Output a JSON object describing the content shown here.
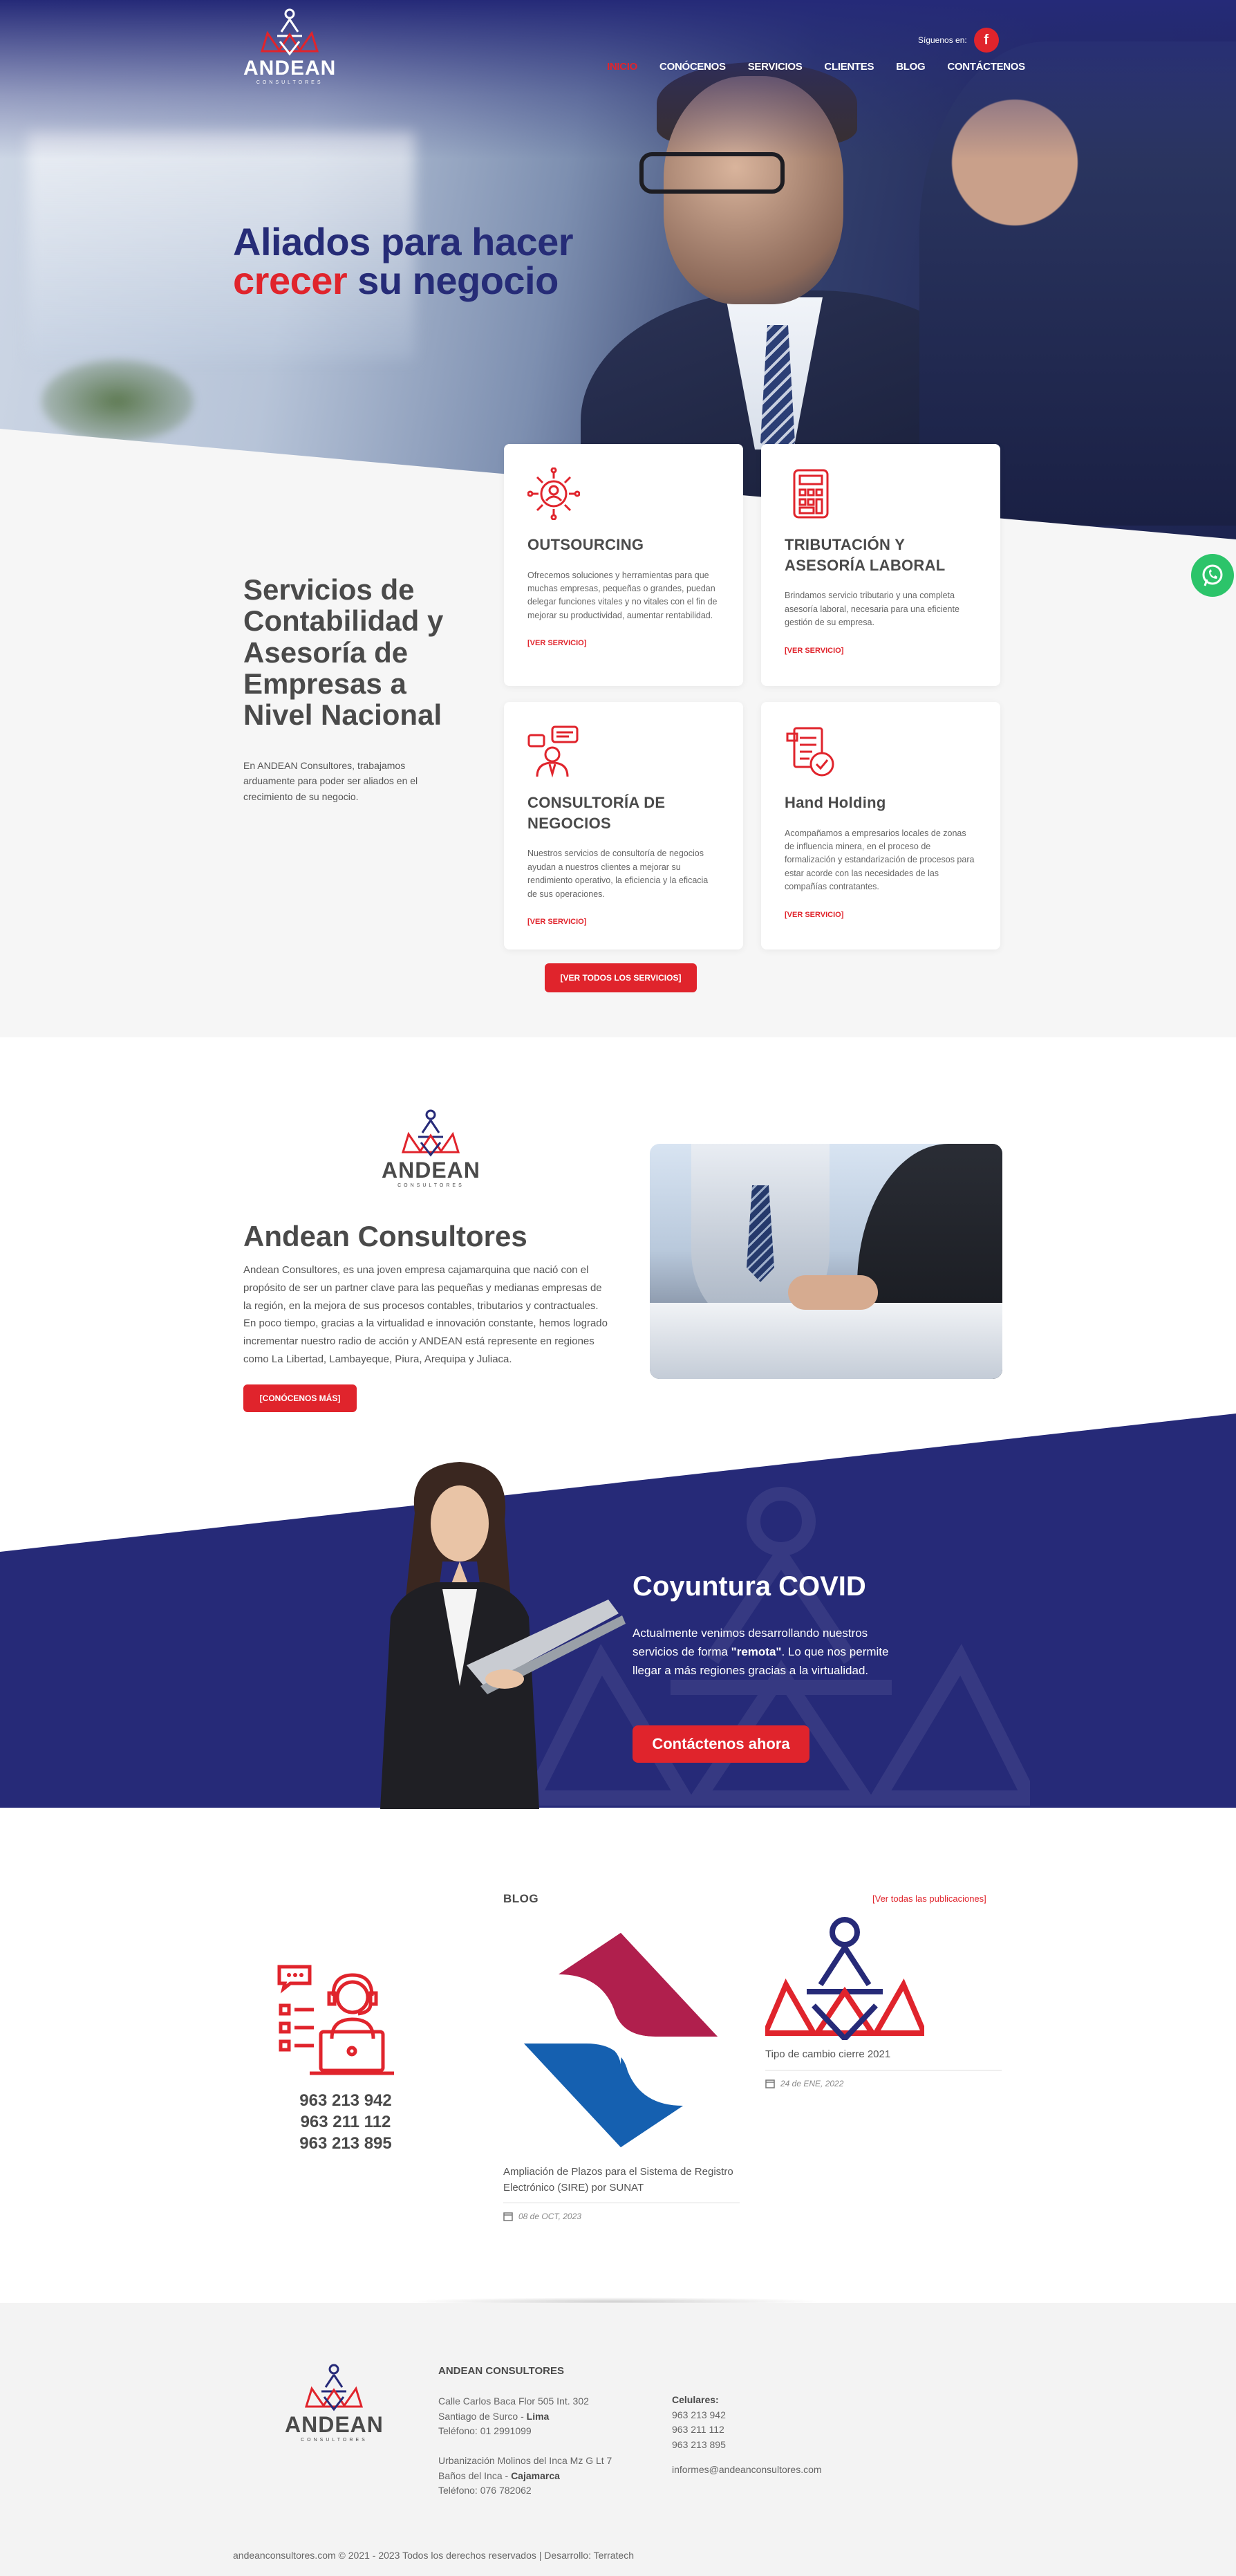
{
  "header": {
    "follow_label": "Síguenos en:",
    "facebook_icon": "f",
    "logo_word": "ANDEAN",
    "logo_sub": "CONSULTORES",
    "nav": [
      "INICIO",
      "CONÓCENOS",
      "SERVICIOS",
      "CLIENTES",
      "BLOG",
      "CONTÁCTENOS"
    ],
    "active_nav": "INICIO"
  },
  "hero": {
    "line1": "Aliados para hacer",
    "red_word": "crecer",
    "line2_rest": " su negocio"
  },
  "services": {
    "title": "Servicios de Contabilidad y Asesoría de Empresas a Nivel Nacional",
    "intro": "En ANDEAN Consultores, trabajamos arduamente para poder ser aliados en el crecimiento de su negocio.",
    "cards": [
      {
        "icon": "outsourcing-icon",
        "title": "OUTSOURCING",
        "text": "Ofrecemos soluciones y herramientas para que muchas empresas, pequeñas o grandes, puedan delegar funciones vitales y no vitales con el fin de mejorar su productividad, aumentar rentabilidad.",
        "link": "[VER SERVICIO]"
      },
      {
        "icon": "calculator-icon",
        "title": "TRIBUTACIÓN Y ASESORÍA LABORAL",
        "text": "Brindamos servicio tributario y una completa asesoría laboral, necesaria para una eficiente gestión de su empresa.",
        "link": "[VER SERVICIO]"
      },
      {
        "icon": "consultant-icon",
        "title": "CONSULTORÍA DE NEGOCIOS",
        "text": "Nuestros servicios de consultoría de negocios ayudan a nuestros clientes a mejorar su rendimiento operativo, la eficiencia y la eficacia de sus operaciones.",
        "link": "[VER SERVICIO]"
      },
      {
        "icon": "document-check-icon",
        "title": "Hand Holding",
        "text": "Acompañamos a empresarios locales de zonas de influencia minera, en el proceso de formalización y estandarización de procesos para estar acorde con las necesidades de las compañías contratantes.",
        "link": "[VER SERVICIO]"
      }
    ],
    "all_button": "[VER TODOS LOS SERVICIOS]"
  },
  "about": {
    "logo_word": "ANDEAN",
    "logo_sub": "CONSULTORES",
    "title": "Andean Consultores",
    "text": "Andean Consultores, es una joven empresa cajamarquina que nació con el propósito de ser un partner clave para las pequeñas y medianas empresas de la región, en la mejora de sus procesos contables, tributarios y contractuales. En poco tiempo, gracias a la virtualidad e innovación constante, hemos logrado incrementar nuestro radio de acción y ANDEAN está represente en regiones como La Libertad, Lambayeque, Piura, Arequipa y Juliaca.",
    "button": "[CONÓCENOS MÁS]"
  },
  "covid": {
    "title_light": "Coyuntura ",
    "title_bold": "COVID",
    "text_before": "Actualmente venimos desarrollando nuestros servicios de forma ",
    "text_bold": "\"remota\"",
    "text_after": ". Lo que nos permite llegar a más regiones gracias a la virtualidad.",
    "button": "Contáctenos ahora"
  },
  "contact": {
    "phones": [
      "963 213 942",
      "963 211 112",
      "963 213 895"
    ]
  },
  "blog": {
    "title": "BLOG",
    "all_link": "[Ver todas las publicaciones]",
    "posts": [
      {
        "title": "Ampliación de Plazos para el Sistema de Registro Electrónico (SIRE) por SUNAT",
        "date": "08 de OCT, 2023"
      },
      {
        "title": "Tipo de cambio cierre 2021",
        "date": "24 de ENE, 2022"
      }
    ]
  },
  "footer": {
    "logo_word": "ANDEAN",
    "logo_sub": "CONSULTORES",
    "company": "ANDEAN CONSULTORES",
    "addr1_line1": "Calle Carlos Baca Flor 505 Int. 302",
    "addr1_line2_pre": "Santiago de Surco - ",
    "addr1_city": "Lima",
    "addr1_phone": "Teléfono: 01 2991099",
    "addr2_line1": "Urbanización Molinos del Inca Mz G Lt 7",
    "addr2_line2_pre": "Baños del Inca - ",
    "addr2_city": "Cajamarca",
    "addr2_phone": "Teléfono: 076 782062",
    "cell_label": "Celulares:",
    "cells": [
      "963 213 942",
      "963 211 112",
      "963 213 895"
    ],
    "email": "informes@andeanconsultores.com",
    "copyright": "andeanconsultores.com © 2021 - 2023 Todos los derechos reservados | Desarrollo: Terratech"
  },
  "colors": {
    "brand_blue": "#262a78",
    "brand_red": "#e0242c",
    "whatsapp_green": "#2cc46a"
  }
}
